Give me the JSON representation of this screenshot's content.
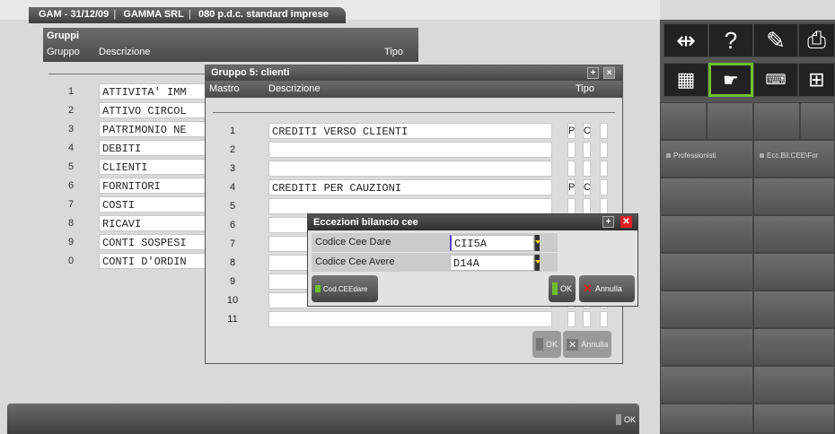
{
  "tab": {
    "date": "GAM - 31/12/09",
    "company": "GAMMA SRL",
    "plan": "080 p.d.c. standard imprese"
  },
  "gruppi": {
    "title": "Gruppi",
    "col_gruppo": "Gruppo",
    "col_descrizione": "Descrizione",
    "col_tipo": "Tipo",
    "rows": [
      {
        "num": "1",
        "desc": "ATTIVITA' IMM"
      },
      {
        "num": "2",
        "desc": "ATTIVO CIRCOL"
      },
      {
        "num": "3",
        "desc": "PATRIMONIO NE"
      },
      {
        "num": "4",
        "desc": "DEBITI"
      },
      {
        "num": "5",
        "desc": "CLIENTI"
      },
      {
        "num": "6",
        "desc": "FORNITORI"
      },
      {
        "num": "7",
        "desc": "COSTI"
      },
      {
        "num": "8",
        "desc": "RICAVI"
      },
      {
        "num": "9",
        "desc": "CONTI SOSPESI"
      },
      {
        "num": "0",
        "desc": "CONTI D'ORDIN"
      }
    ]
  },
  "gruppo5": {
    "title": "Gruppo 5: clienti",
    "col_mastro": "Mastro",
    "col_descrizione": "Descrizione",
    "col_tipo": "Tipo",
    "rows": [
      {
        "num": "1",
        "desc": "CREDITI VERSO CLIENTI",
        "t1": "P",
        "t2": "C"
      },
      {
        "num": "2",
        "desc": "",
        "t1": "",
        "t2": ""
      },
      {
        "num": "3",
        "desc": "",
        "t1": "",
        "t2": ""
      },
      {
        "num": "4",
        "desc": "CREDITI PER CAUZIONI",
        "t1": "P",
        "t2": "C"
      },
      {
        "num": "5",
        "desc": "",
        "t1": "",
        "t2": ""
      },
      {
        "num": "6",
        "desc": "",
        "t1": "",
        "t2": ""
      },
      {
        "num": "7",
        "desc": "",
        "t1": "",
        "t2": ""
      },
      {
        "num": "8",
        "desc": "",
        "t1": "",
        "t2": ""
      },
      {
        "num": "9",
        "desc": "",
        "t1": "",
        "t2": ""
      },
      {
        "num": "10",
        "desc": "",
        "t1": "",
        "t2": ""
      },
      {
        "num": "11",
        "desc": "",
        "t1": "",
        "t2": ""
      }
    ],
    "ok_label": "OK",
    "annulla_label": "Annulla"
  },
  "eccezioni": {
    "title": "Eccezioni bilancio cee",
    "dare_label": "Codice Cee Dare",
    "dare_value": "CII5A",
    "avere_label": "Codice Cee Avere",
    "avere_value": "D14A",
    "codcee_label": "Cod.CEEdare",
    "ok_label": "OK",
    "annulla_label": "Annulla"
  },
  "bottom": {
    "ok_label": "OK"
  },
  "right_panel": {
    "professionisti_label": "Professionisti",
    "ecc_label": "Ecc.Bil.CEE\\For"
  },
  "colors": {
    "accent_green": "#6fbf2a",
    "close_red": "#e02020",
    "field_border": "#c8c8c8"
  }
}
